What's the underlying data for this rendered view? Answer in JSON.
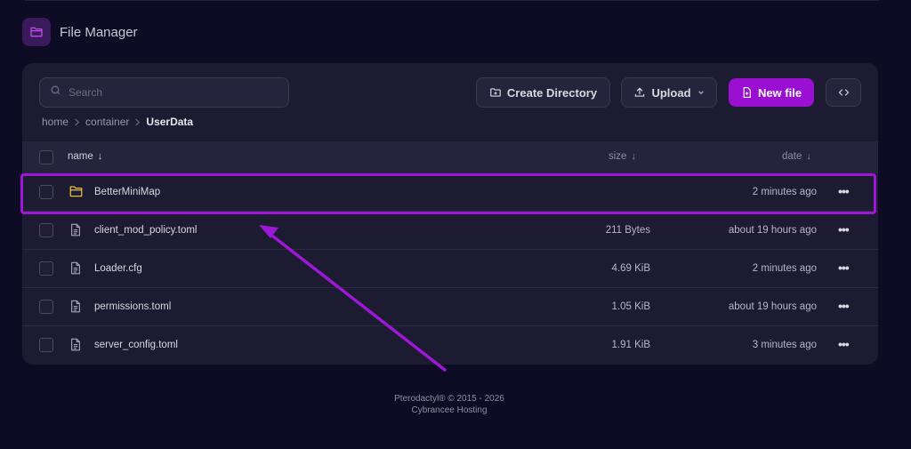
{
  "header": {
    "title": "File Manager",
    "icon": "folder-icon"
  },
  "search": {
    "placeholder": "Search",
    "value": ""
  },
  "toolbar": {
    "create_directory_label": "Create Directory",
    "upload_label": "Upload",
    "new_file_label": "New file",
    "accent_color": "#9a0fd2"
  },
  "breadcrumb": {
    "items": [
      "home",
      "container"
    ],
    "current": "UserData"
  },
  "table": {
    "columns": {
      "name": "name",
      "size": "size",
      "date": "date"
    },
    "sort_arrow": "↓",
    "rows": [
      {
        "type": "folder",
        "name": "BetterMiniMap",
        "size": "",
        "date": "2 minutes ago",
        "highlighted": true
      },
      {
        "type": "file",
        "name": "client_mod_policy.toml",
        "size": "211 Bytes",
        "date": "about 19 hours ago"
      },
      {
        "type": "file",
        "name": "Loader.cfg",
        "size": "4.69 KiB",
        "date": "2 minutes ago"
      },
      {
        "type": "file",
        "name": "permissions.toml",
        "size": "1.05 KiB",
        "date": "about 19 hours ago"
      },
      {
        "type": "file",
        "name": "server_config.toml",
        "size": "1.91 KiB",
        "date": "3 minutes ago"
      }
    ],
    "menu_glyph": "•••"
  },
  "annotation": {
    "color": "#9d17d6"
  },
  "footer": {
    "line1": "Pterodactyl® © 2015 - 2026",
    "line2": "Cybrancee Hosting"
  }
}
